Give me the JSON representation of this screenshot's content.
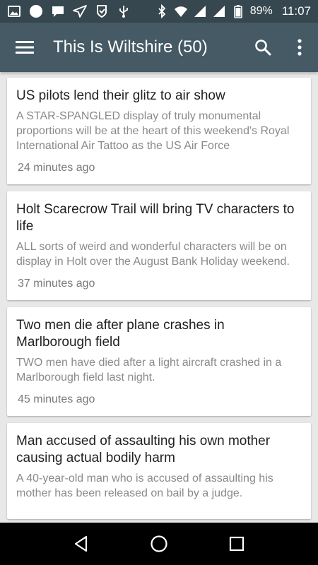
{
  "status_bar": {
    "battery": "89%",
    "time": "11:07"
  },
  "app_bar": {
    "title": "This Is Wiltshire (50)",
    "icons": [
      "menu-icon",
      "search-icon",
      "more-vert-icon"
    ]
  },
  "articles": [
    {
      "title": "US pilots lend their glitz to air show",
      "summary": "A STAR-SPANGLED display of truly monumental proportions will be at the heart of this weekend's Royal International Air Tattoo as the US Air Force",
      "time": "24 minutes ago"
    },
    {
      "title": "Holt Scarecrow Trail will bring TV characters to life",
      "summary": "ALL sorts of weird and wonderful characters will be on display in Holt over the August Bank Holiday weekend.",
      "time": "37 minutes ago"
    },
    {
      "title": "Two men die after plane crashes in Marlborough field",
      "summary": "TWO men have died after a light aircraft crashed in a Marlborough field last night.",
      "time": "45 minutes ago"
    },
    {
      "title": "Man accused of assaulting his own mother causing actual bodily harm",
      "summary": "A 40-year-old man who is accused of assaulting his mother has been released on bail by a judge.",
      "time": ""
    }
  ],
  "colors": {
    "status_bar": "#37474f",
    "app_bar": "#455a64",
    "background": "#e8e8e8"
  }
}
